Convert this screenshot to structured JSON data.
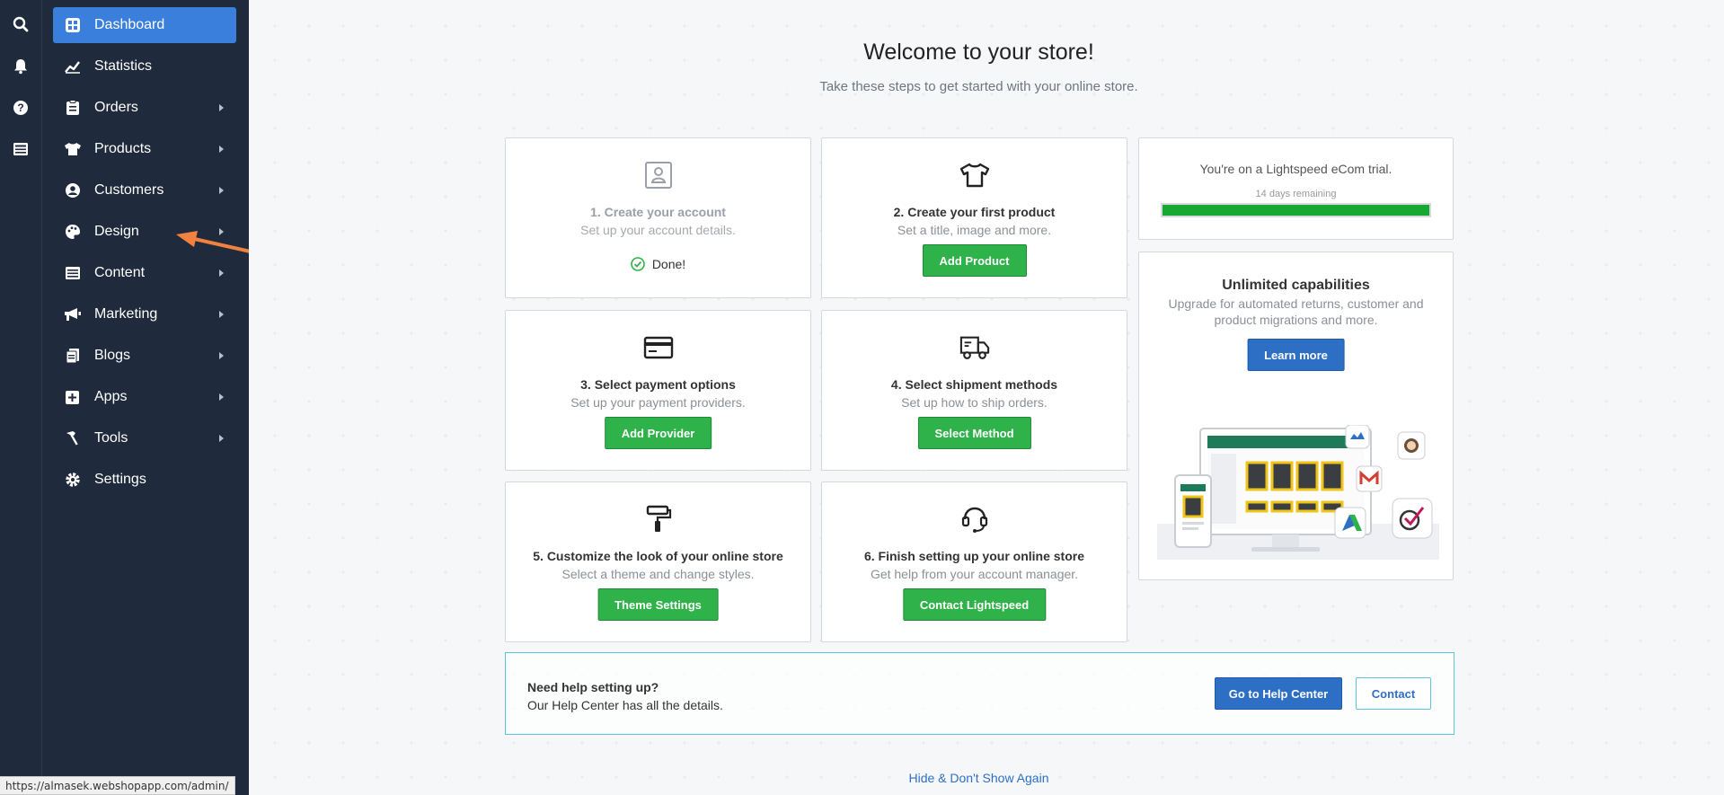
{
  "rail": {
    "search": "search-icon",
    "notifications": "bell-icon",
    "help": "help-icon",
    "news": "newspaper-icon"
  },
  "sidebar": {
    "items": [
      {
        "label": "Dashboard",
        "icon": "dashboard-icon",
        "active": true,
        "has_submenu": false
      },
      {
        "label": "Statistics",
        "icon": "chart-line-icon",
        "active": false,
        "has_submenu": false
      },
      {
        "label": "Orders",
        "icon": "clipboard-icon",
        "active": false,
        "has_submenu": true
      },
      {
        "label": "Products",
        "icon": "tshirt-icon",
        "active": false,
        "has_submenu": true
      },
      {
        "label": "Customers",
        "icon": "user-icon",
        "active": false,
        "has_submenu": true
      },
      {
        "label": "Design",
        "icon": "palette-icon",
        "active": false,
        "has_submenu": true
      },
      {
        "label": "Content",
        "icon": "layout-icon",
        "active": false,
        "has_submenu": true
      },
      {
        "label": "Marketing",
        "icon": "megaphone-icon",
        "active": false,
        "has_submenu": true
      },
      {
        "label": "Blogs",
        "icon": "pages-icon",
        "active": false,
        "has_submenu": true
      },
      {
        "label": "Apps",
        "icon": "app-plus-icon",
        "active": false,
        "has_submenu": true
      },
      {
        "label": "Tools",
        "icon": "hammer-icon",
        "active": false,
        "has_submenu": true
      },
      {
        "label": "Settings",
        "icon": "gear-icon",
        "active": false,
        "has_submenu": false
      }
    ]
  },
  "main": {
    "title": "Welcome to your store!",
    "subtitle": "Take these steps to get started with your online store.",
    "steps": [
      {
        "title": "1. Create your account",
        "desc": "Set up your account details.",
        "status": "Done!",
        "icon": "account-icon"
      },
      {
        "title": "2. Create your first product",
        "desc": "Set a title, image and more.",
        "button": "Add Product",
        "icon": "tshirt-icon"
      },
      {
        "title": "3. Select payment options",
        "desc": "Set up your payment providers.",
        "button": "Add Provider",
        "icon": "credit-card-icon"
      },
      {
        "title": "4. Select shipment methods",
        "desc": "Set up how to ship orders.",
        "button": "Select Method",
        "icon": "truck-icon"
      },
      {
        "title": "5. Customize the look of your online store",
        "desc": "Select a theme and change styles.",
        "button": "Theme Settings",
        "icon": "paint-roller-icon"
      },
      {
        "title": "6. Finish setting up your online store",
        "desc": "Get help from your account manager.",
        "button": "Contact Lightspeed",
        "icon": "headset-icon"
      }
    ],
    "trial": {
      "text": "You're on a Lightspeed eCom trial.",
      "days": "14 days remaining",
      "progress": 1.0
    },
    "capabilities": {
      "title": "Unlimited capabilities",
      "desc": "Upgrade for automated returns, customer and product migrations and more.",
      "button": "Learn more"
    },
    "help": {
      "title": "Need help setting up?",
      "subtitle": "Our Help Center has all the details.",
      "help_button": "Go to Help Center",
      "contact_button": "Contact"
    },
    "hide_link": "Hide & Don't Show Again"
  },
  "status_bar": {
    "url": "https://almasek.webshopapp.com/admin/"
  },
  "colors": {
    "sidebar_bg": "#1f2a3c",
    "active": "#3b7fdc",
    "green": "#2fb24a",
    "blue": "#2e6fc6",
    "annotation_arrow": "#f0813f"
  }
}
